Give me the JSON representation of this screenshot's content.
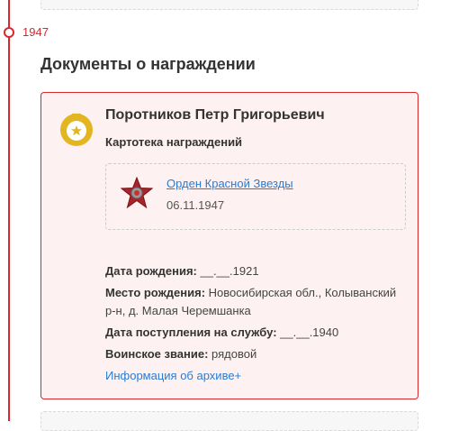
{
  "timeline": {
    "year": "1947",
    "accent_color": "#d8272d"
  },
  "section": {
    "title": "Документы о награждении"
  },
  "card": {
    "person_name": "Поротников Петр Григорьевич",
    "doc_type": "Картотека награждений",
    "badge_icon": "medal-badge-icon",
    "award": {
      "icon": "red-star-order-icon",
      "name": "Орден Красной Звезды",
      "date": "06.11.1947"
    },
    "details": {
      "birth_date_label": "Дата рождения:",
      "birth_date_value": " __.__.1921",
      "birth_place_label": "Место рождения:",
      "birth_place_value": " Новосибирская обл., Колыванский р-н, д. Малая Черемшанка",
      "service_start_label": "Дата поступления на службу:",
      "service_start_value": " __.__.1940",
      "rank_label": "Воинское звание:",
      "rank_value": " рядовой"
    },
    "archive_link": "Информация об архиве+"
  },
  "colors": {
    "link": "#2a7cd3",
    "card_bg": "#fdf1f1",
    "gold": "#e2b521"
  }
}
